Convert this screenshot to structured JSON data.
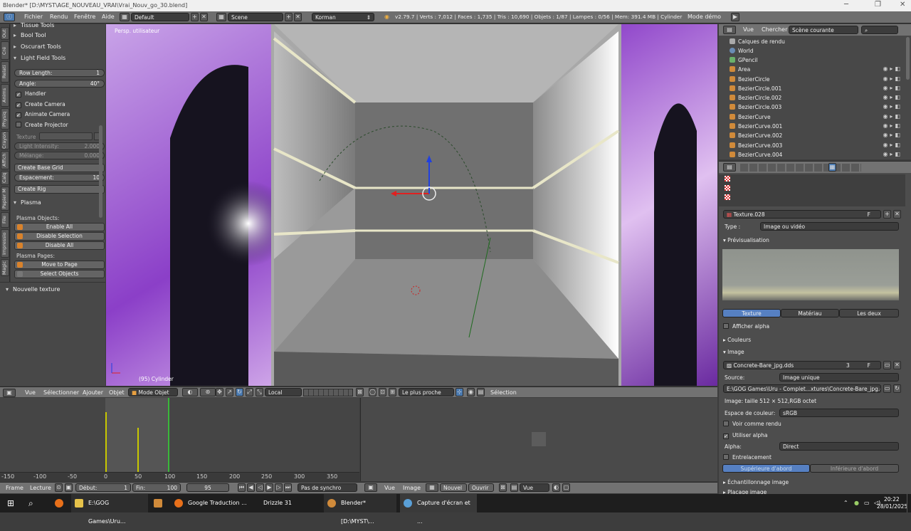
{
  "titlebar": {
    "title": "Blender* [D:\\MYST\\AGE_NOUVEAU_VRAI\\Vrai_Nouv_go_30.blend]"
  },
  "menu": {
    "items": [
      "Fichier",
      "Rendu",
      "Fenêtre",
      "Aide"
    ],
    "layout": "Default",
    "scene": "Scene",
    "engine": "Korman",
    "stats": "v2.79.7 | Verts : 7,012 | Faces : 1,735 | Tris : 10,690 | Objets : 1/87 | Lampes : 0/56 | Mem: 391.4 MB | Cylinder",
    "demo": "Mode démo"
  },
  "left_tabs": [
    "Out",
    "Cré",
    "Relati",
    "Anims",
    "Physiq",
    "Crayon",
    "Affich",
    "Calq",
    "Papier M",
    "File",
    "Impressio",
    "Magic"
  ],
  "toolshelf": {
    "tissue": "Tissue Tools",
    "bool": "Bool Tool",
    "oscurart": "Oscurart Tools",
    "lightfield": "Light Field Tools",
    "row_length_label": "Row Length:",
    "row_length": "1",
    "angle_label": "Angle:",
    "angle": "40°",
    "handler": "Handler",
    "create_camera": "Create Camera",
    "animate_camera": "Animate Camera",
    "create_projector": "Create Projector",
    "texture": "Texture",
    "light_intensity_label": "Light Intensity:",
    "light_intensity": "2.000",
    "melange_label": "Mélange:",
    "melange": "0.000",
    "create_base_grid": "Create Base Grid",
    "espacement_label": "Espacement:",
    "espacement": "10",
    "create_rig": "Create Rig",
    "plasma": "Plasma",
    "plasma_objects": "Plasma Objects:",
    "enable_all": "Enable All",
    "disable_selection": "Disable Selection",
    "disable_all": "Disable All",
    "plasma_pages": "Plasma Pages:",
    "move_to_page": "Move to Page",
    "select_objects": "Select Objects",
    "nouvelle_texture": "Nouvelle texture"
  },
  "viewport": {
    "label": "Persp. utilisateur",
    "object_label": "(95) Cylinder"
  },
  "viewport_header": {
    "vue": "Vue",
    "selectionner": "Sélectionner",
    "ajouter": "Ajouter",
    "objet": "Objet",
    "mode": "Mode Objet",
    "pivot": "Local",
    "snap": "Le plus proche",
    "selection": "Sélection"
  },
  "timeline": {
    "ticks": [
      "-150",
      "-100",
      "-50",
      "0",
      "50",
      "100",
      "150",
      "200",
      "250",
      "300",
      "350"
    ]
  },
  "bottombar": {
    "frame": "Frame",
    "lecture": "Lecture",
    "debut_label": "Début:",
    "debut": "1",
    "fin_label": "Fin:",
    "fin": "100",
    "current": "95",
    "sync": "Pas de synchro",
    "vue": "Vue",
    "image": "Image",
    "nouvel": "Nouvel",
    "ouvrir": "Ouvrir",
    "vue2": "Vue"
  },
  "outliner": {
    "vue": "Vue",
    "chercher": "Chercher",
    "scope": "Scène courante",
    "items": [
      "Calques de rendu",
      "World",
      "GPencil",
      "Area",
      "BezierCircle",
      "BezierCircle.001",
      "BezierCircle.002",
      "BezierCircle.003",
      "BezierCurve",
      "BezierCurve.001",
      "BezierCurve.002",
      "BezierCurve.003",
      "BezierCurve.004"
    ]
  },
  "props": {
    "texture_name": "Texture.028",
    "f": "F",
    "type_label": "Type :",
    "type": "Image ou vidéo",
    "previs": "Prévisualisation",
    "tabs": [
      "Texture",
      "Matériau",
      "Les deux"
    ],
    "afficher_alpha": "Afficher alpha",
    "couleurs": "Couleurs",
    "image": "Image",
    "image_name": "Concrete-Bare_jpg.dds",
    "users": "3",
    "source_label": "Source:",
    "source": "Image unique",
    "path": "E:\\GOG Games\\Uru - Complet...xtures\\Concrete-Bare_jpg.dds",
    "info": "Image: taille 512 × 512,RGB octet",
    "espace_label": "Espace de couleur:",
    "espace": "sRGB",
    "voir_rendu": "Voir comme rendu",
    "utiliser_alpha": "Utiliser alpha",
    "alpha_label": "Alpha:",
    "alpha": "Direct",
    "entrelacement": "Entrelacement",
    "sup": "Supérieure d'abord",
    "inf": "Inférieure d'abord",
    "echantillonnage": "Échantillonnage image",
    "placage": "Placage image"
  },
  "taskbar": {
    "items": [
      "E:\\GOG Games\\Uru...",
      "Google Traduction ...",
      "Drizzle 31",
      "Blender* [D:\\MYST\\...",
      "Capture d'écran et ..."
    ],
    "time": "20:22",
    "date": "28/01/2025"
  }
}
